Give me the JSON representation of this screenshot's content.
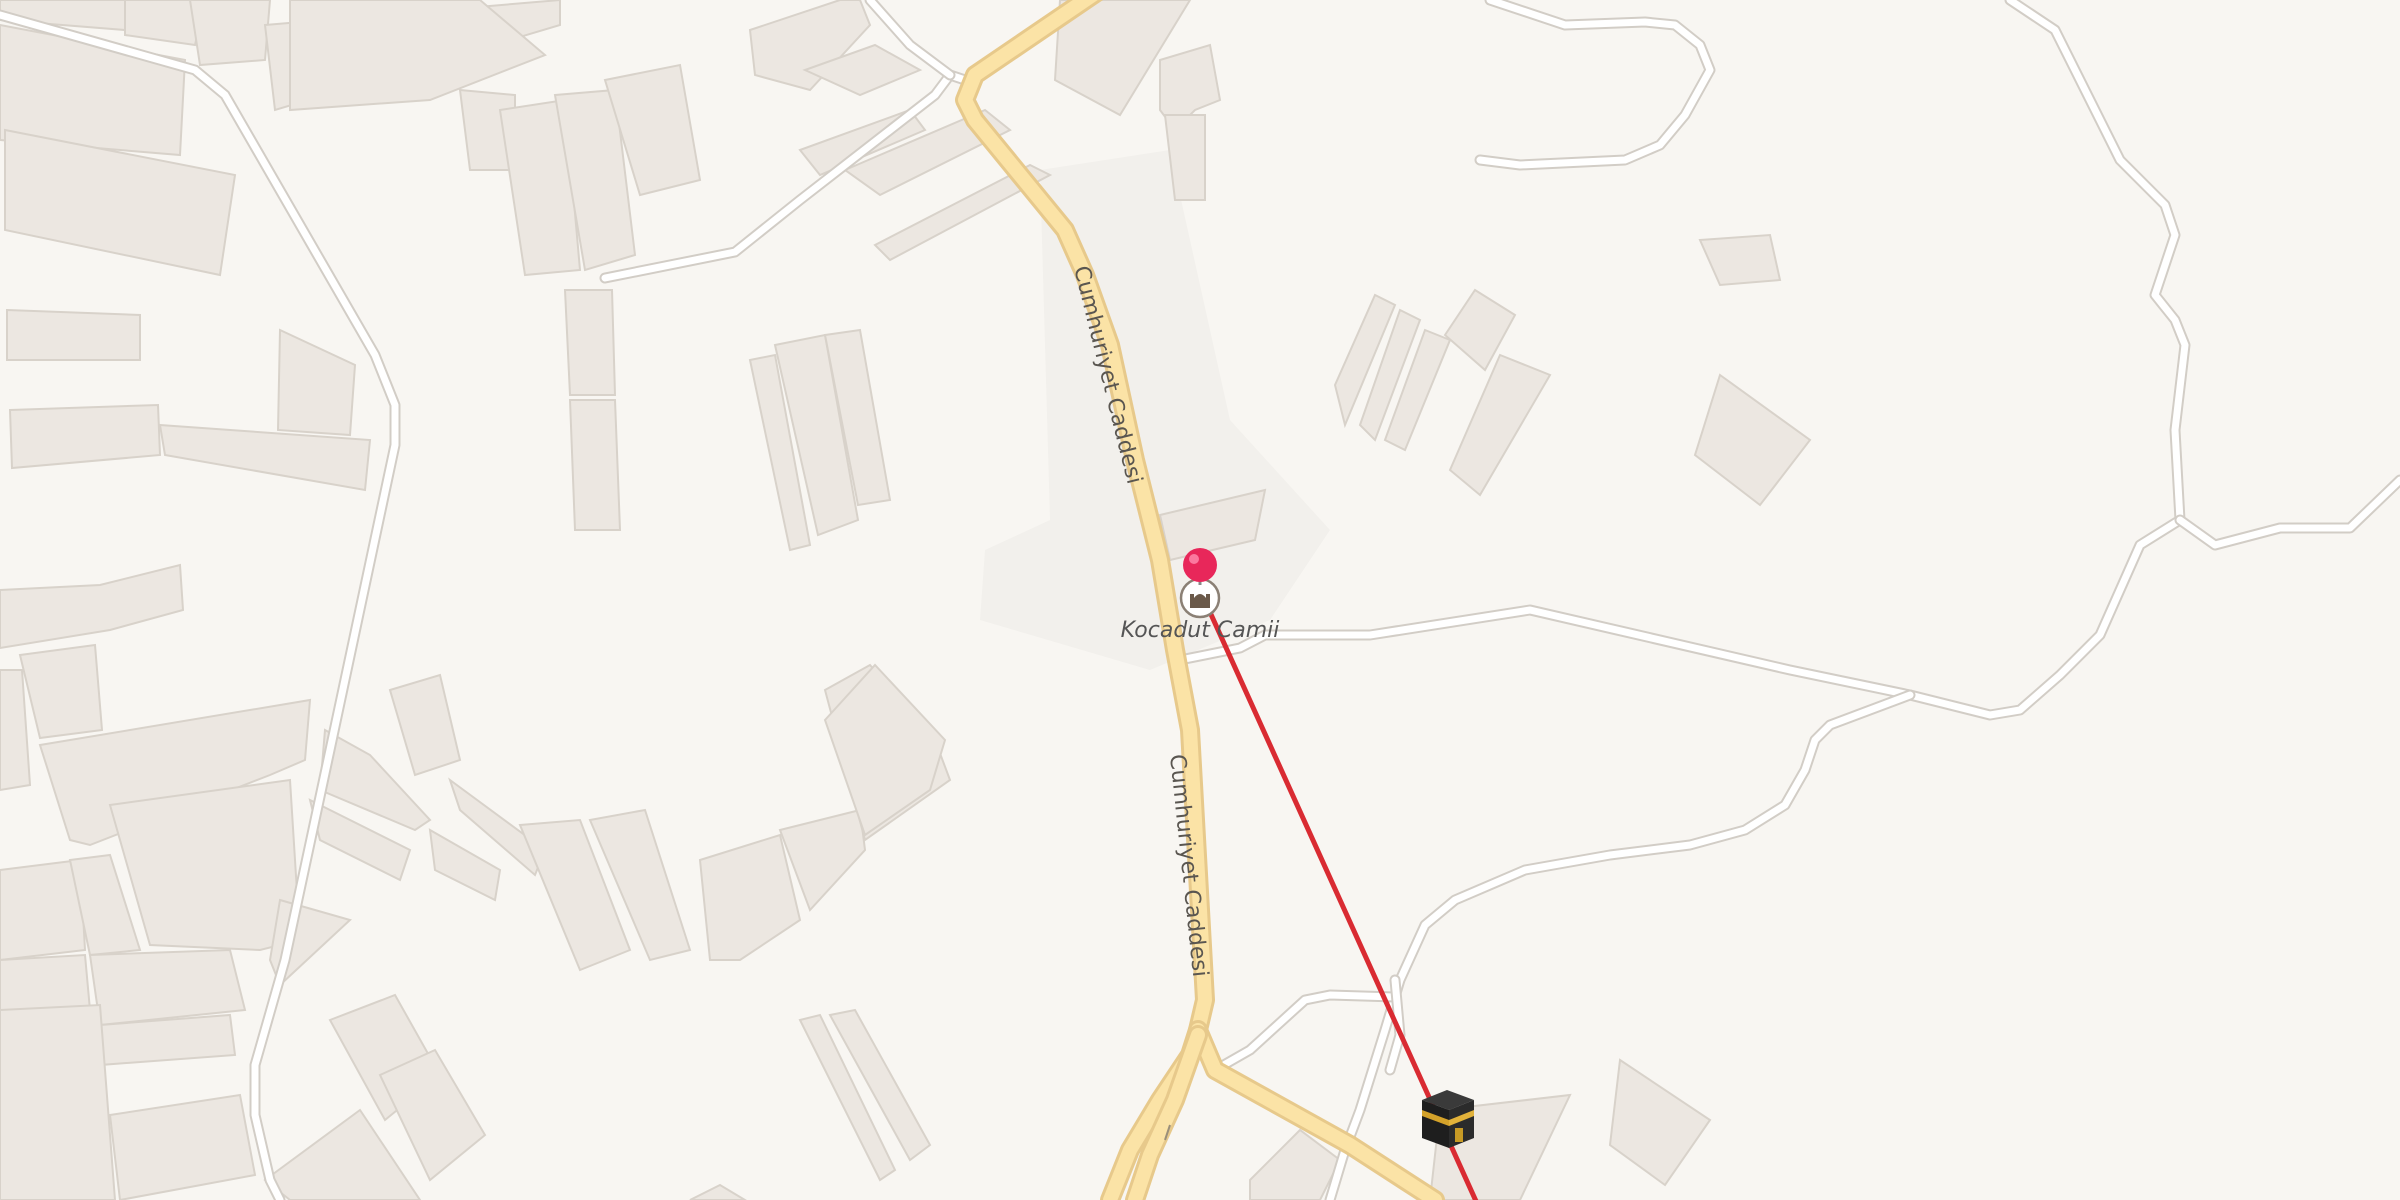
{
  "map": {
    "type": "street-map",
    "roads": [
      {
        "name": "Cumhuriyet Caddesi",
        "class": "major"
      },
      {
        "name": "Cumhuriyet Caddesi",
        "class": "major"
      }
    ],
    "pois": [
      {
        "name": "Kocadut Camii",
        "category": "mosque",
        "icon": "mosque-icon"
      }
    ],
    "markers": [
      {
        "icon": "map-pin-icon",
        "color": "#e8275a"
      },
      {
        "icon": "kaaba-icon",
        "label": ""
      }
    ],
    "qibla_line": {
      "color": "#d92b32"
    }
  },
  "colors": {
    "background": "#f8f6f2",
    "building": "#ece7e1",
    "minor_road": "#ffffff",
    "major_road": "#fbe3a6",
    "qibla_line": "#d92b32",
    "pin": "#e8275a"
  }
}
